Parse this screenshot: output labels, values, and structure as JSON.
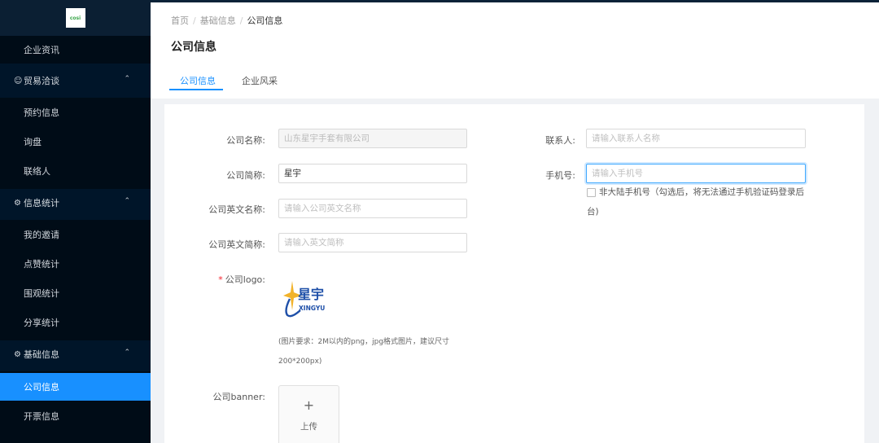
{
  "brand": {
    "logo_text": "cosi"
  },
  "sidebar": {
    "items": [
      {
        "label": "企业资讯"
      },
      {
        "label": "贸易洽谈",
        "icon": "user-icon",
        "type": "group"
      },
      {
        "label": "预约信息"
      },
      {
        "label": "询盘"
      },
      {
        "label": "联络人"
      },
      {
        "label": "信息统计",
        "icon": "gear-icon",
        "type": "group"
      },
      {
        "label": "我的邀请"
      },
      {
        "label": "点赞统计"
      },
      {
        "label": "围观统计"
      },
      {
        "label": "分享统计"
      },
      {
        "label": "基础信息",
        "icon": "settings-icon",
        "type": "group"
      },
      {
        "label": "公司信息",
        "active": true
      },
      {
        "label": "开票信息"
      }
    ]
  },
  "breadcrumb": {
    "home": "首页",
    "section": "基础信息",
    "current": "公司信息",
    "separator": "/"
  },
  "page": {
    "title": "公司信息"
  },
  "tabs": [
    {
      "label": "公司信息",
      "active": true
    },
    {
      "label": "企业风采"
    }
  ],
  "form": {
    "company_name": {
      "label": "公司名称:",
      "value": "山东星宇手套有限公司",
      "disabled": true
    },
    "short_name": {
      "label": "公司简称:",
      "value": "星宇"
    },
    "english_name": {
      "label": "公司英文名称:",
      "placeholder": "请输入公司英文名称"
    },
    "english_short": {
      "label": "公司英文简称:",
      "placeholder": "请输入英文简称"
    },
    "logo": {
      "label": "公司logo:",
      "required_mark": "*",
      "logo_text": "星宇",
      "logo_sub": "XINGYU",
      "hint_line1": "(图片要求：2M以内的png，jpg格式图片，建议尺寸",
      "hint_line2": "200*200px)"
    },
    "banner": {
      "label": "公司banner:",
      "plus": "+",
      "upload_label": "上传"
    },
    "contact": {
      "label": "联系人:",
      "placeholder": "请输入联系人名称"
    },
    "phone": {
      "label": "手机号:",
      "placeholder": "请输入手机号"
    },
    "non_mainland": {
      "label_line1": "非大陆手机号（勾选后，将无法通过手机验证码登录后",
      "label_line2": "台)",
      "checked": false
    }
  },
  "colors": {
    "sidebar_bg": "#001529",
    "accent": "#1890ff",
    "required": "#f5222d"
  }
}
